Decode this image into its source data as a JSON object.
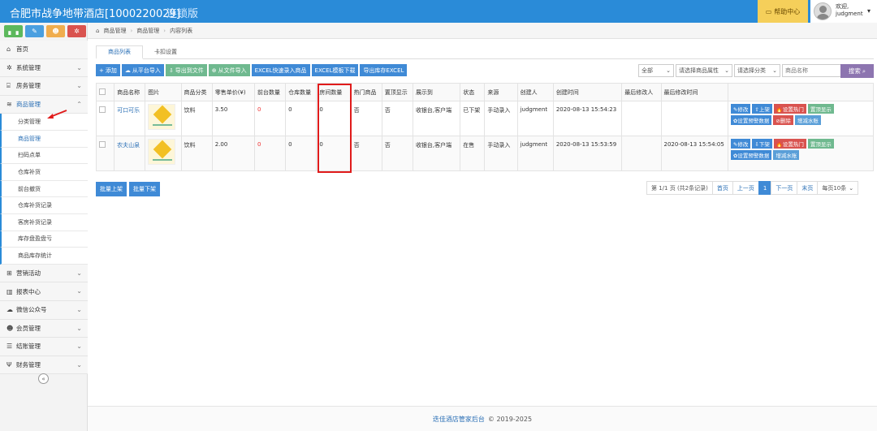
{
  "header": {
    "title": "合肥市战争地带酒店[1000220029]",
    "edition": "连锁版",
    "help": "帮助中心",
    "welcome": "欢迎,",
    "user": "judgment"
  },
  "sidebar": {
    "menu": [
      {
        "label": "首页",
        "icon": "home-icon",
        "glyph": "⌂",
        "chev": ""
      },
      {
        "label": "系统管理",
        "icon": "gear-icon",
        "glyph": "✲",
        "chev": "⌄"
      },
      {
        "label": "房务管理",
        "icon": "building-icon",
        "glyph": "⌸",
        "chev": "⌄"
      },
      {
        "label": "商品管理",
        "icon": "database-icon",
        "glyph": "≋",
        "chev": "⌃"
      }
    ],
    "submenu": [
      "分类管理",
      "商品管理",
      "扫码点单",
      "仓库补货",
      "前台撤货",
      "仓库补货记录",
      "客房补货记录",
      "库存盘盈盘亏",
      "商品库存统计"
    ],
    "menu2": [
      {
        "label": "营销活动",
        "icon": "gift-icon",
        "glyph": "⊞"
      },
      {
        "label": "报表中心",
        "icon": "bar-chart-icon",
        "glyph": "▥"
      },
      {
        "label": "微信公众号",
        "icon": "cloud-icon",
        "glyph": "☁"
      },
      {
        "label": "会员管理",
        "icon": "users-icon",
        "glyph": "☻"
      },
      {
        "label": "结账管理",
        "icon": "list-icon",
        "glyph": "☰"
      },
      {
        "label": "财务管理",
        "icon": "cutlery-icon",
        "glyph": "Ψ"
      }
    ]
  },
  "breadcrumb": [
    "商品管理",
    "商品管理",
    "内容列表"
  ],
  "tabs": [
    "商品列表",
    "卡扣设置"
  ],
  "toolbar": [
    {
      "label": "添加",
      "glyph": "+",
      "cls": "tb-blue"
    },
    {
      "label": "从平台导入",
      "glyph": "☁",
      "cls": "tb-blue"
    },
    {
      "label": "导出到文件",
      "glyph": "⇩",
      "cls": "tb-lgreen"
    },
    {
      "label": "从文件导入",
      "glyph": "⊕",
      "cls": "tb-lgreen"
    },
    {
      "label": "EXCEL快速录入商品",
      "glyph": "",
      "cls": "tb-blue"
    },
    {
      "label": "EXCEL模板下载",
      "glyph": "",
      "cls": "tb-blue"
    },
    {
      "label": "导出库存EXCEL",
      "glyph": "",
      "cls": "tb-blue"
    }
  ],
  "filters": {
    "status": "全部",
    "attr": "请选择商品属性",
    "category": "请选择分类",
    "name_placeholder": "商品名称",
    "search": "搜索"
  },
  "table": {
    "columns": [
      "商品名称",
      "图片",
      "商品分类",
      "零售单价(¥)",
      "前台数量",
      "仓库数量",
      "房间数量",
      "热门商品",
      "置顶显示",
      "展示到",
      "状态",
      "来源",
      "创建人",
      "创建时间",
      "最后修改人",
      "最后修改时间"
    ],
    "rows": [
      {
        "name": "可口可乐",
        "category": "饮料",
        "price": "3.50",
        "front": "0",
        "warehouse": "0",
        "room": "0",
        "hot": "否",
        "top": "否",
        "display": "收银台,客户端",
        "status": "已下架",
        "source": "手动录入",
        "creator": "judgment",
        "created": "2020-08-13 15:54:23",
        "modifier": "",
        "modified": "",
        "ops": [
          {
            "label": "✎修改",
            "cls": "ob-blue"
          },
          {
            "label": "⇧上架",
            "cls": "ob-blue"
          },
          {
            "label": "🔥设置热门",
            "cls": "ob-red"
          },
          {
            "label": "置顶显示",
            "cls": "ob-green"
          },
          {
            "label": "✿设置预警数据",
            "cls": "ob-blue"
          },
          {
            "label": "⊘删除",
            "cls": "ob-red"
          },
          {
            "label": "增减水账",
            "cls": "ob-lblue"
          }
        ]
      },
      {
        "name": "农夫山泉",
        "category": "饮料",
        "price": "2.00",
        "front": "0",
        "warehouse": "0",
        "room": "0",
        "hot": "否",
        "top": "否",
        "display": "收银台,客户端",
        "status": "在售",
        "source": "手动录入",
        "creator": "judgment",
        "created": "2020-08-13 15:53:59",
        "modifier": "",
        "modified": "2020-08-13 15:54:05",
        "ops": [
          {
            "label": "✎修改",
            "cls": "ob-blue"
          },
          {
            "label": "⇩下架",
            "cls": "ob-blue"
          },
          {
            "label": "🔥设置热门",
            "cls": "ob-red"
          },
          {
            "label": "置顶显示",
            "cls": "ob-green"
          },
          {
            "label": "✿设置预警数据",
            "cls": "ob-blue"
          },
          {
            "label": "增减水账",
            "cls": "ob-lblue"
          }
        ]
      }
    ]
  },
  "batch": [
    "批量上架",
    "批量下架"
  ],
  "pager": {
    "info": "第 1/1 页 (共2条记录)",
    "first": "首页",
    "prev": "上一页",
    "current": "1",
    "next": "下一页",
    "last": "末页",
    "size": "每页10条"
  },
  "footer": {
    "brand": "迭佳酒店管家后台",
    "copy": "© 2019-2025"
  },
  "colors": {
    "topbar": "#2a8bd8",
    "highlight": "#e01b1b"
  }
}
